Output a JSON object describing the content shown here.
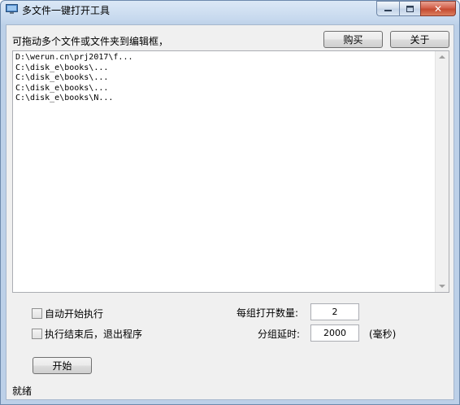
{
  "window": {
    "title": "多文件一键打开工具",
    "icon": "monitor-icon",
    "accent_color": "#c54b31"
  },
  "header": {
    "hint": "可拖动多个文件或文件夹到编辑框，",
    "buy_label": "购买",
    "about_label": "关于"
  },
  "editor": {
    "lines": [
      "D:\\werun.cn\\prj2017\\f...",
      "C:\\disk_e\\books\\...",
      "C:\\disk_e\\books\\...",
      "C:\\disk_e\\books\\...",
      "C:\\disk_e\\books\\N..."
    ]
  },
  "options": {
    "auto_start_label": "自动开始执行",
    "auto_start_checked": false,
    "exit_after_label": "执行结束后，退出程序",
    "exit_after_checked": false,
    "count_label": "每组打开数量:",
    "count_value": "2",
    "delay_label": "分组延时:",
    "delay_value": "2000",
    "delay_unit": "(毫秒)"
  },
  "actions": {
    "start_label": "开始"
  },
  "status": {
    "text": "就绪"
  }
}
